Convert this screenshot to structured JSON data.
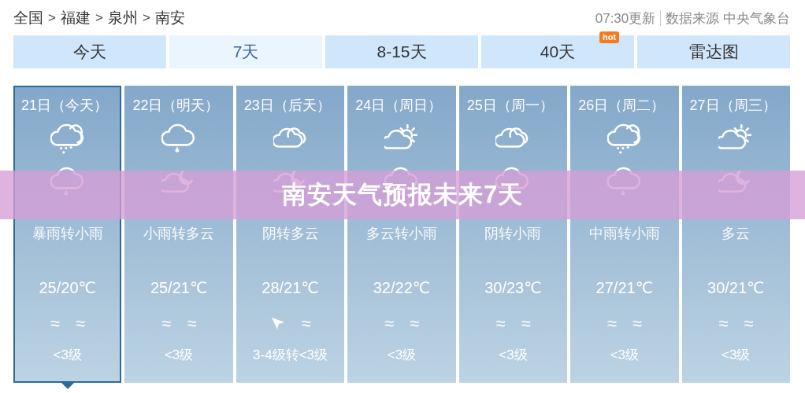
{
  "breadcrumb": [
    "全国",
    "福建",
    "泉州",
    "南安"
  ],
  "breadcrumb_separator": ">",
  "update_time": "07:30更新",
  "source": "数据来源 中央气象台",
  "tabs": [
    {
      "label": "今天",
      "selected": false
    },
    {
      "label": "7天",
      "selected": true
    },
    {
      "label": "8-15天",
      "selected": false
    },
    {
      "label": "40天",
      "selected": false,
      "badge": "hot"
    },
    {
      "label": "雷达图",
      "selected": false
    }
  ],
  "days": [
    {
      "date": "21日（今天）",
      "day_icon": {
        "kind": "heavy_rain"
      },
      "night_icon": {
        "kind": "rain"
      },
      "weather": "暴雨转小雨",
      "temp": "25/20℃",
      "wind": [
        {
          "kind": "text",
          "text": "≈"
        },
        {
          "kind": "text",
          "text": "≈"
        }
      ],
      "level": "<3级",
      "selected": true
    },
    {
      "date": "22日（明天）",
      "day_icon": {
        "kind": "rain"
      },
      "night_icon": {
        "kind": "moon_cloud"
      },
      "weather": "小雨转多云",
      "temp": "25/21℃",
      "wind": [
        {
          "kind": "text",
          "text": "≈"
        },
        {
          "kind": "text",
          "text": "≈"
        }
      ],
      "level": "<3级",
      "selected": false
    },
    {
      "date": "23日（后天）",
      "day_icon": {
        "kind": "overcast"
      },
      "night_icon": {
        "kind": "moon_cloud"
      },
      "weather": "阴转多云",
      "temp": "28/21℃",
      "wind": [
        {
          "kind": "arrow"
        },
        {
          "kind": "text",
          "text": "≈"
        }
      ],
      "level": "3-4级转<3级",
      "selected": false
    },
    {
      "date": "24日（周日）",
      "day_icon": {
        "kind": "sun_cloud"
      },
      "night_icon": {
        "kind": "rain"
      },
      "weather": "多云转小雨",
      "temp": "32/22℃",
      "wind": [
        {
          "kind": "text",
          "text": "≈"
        },
        {
          "kind": "text",
          "text": "≈"
        }
      ],
      "level": "<3级",
      "selected": false
    },
    {
      "date": "25日（周一）",
      "day_icon": {
        "kind": "overcast"
      },
      "night_icon": {
        "kind": "rain"
      },
      "weather": "阴转小雨",
      "temp": "30/23℃",
      "wind": [
        {
          "kind": "text",
          "text": "≈"
        },
        {
          "kind": "text",
          "text": "≈"
        }
      ],
      "level": "<3级",
      "selected": false
    },
    {
      "date": "26日（周二）",
      "day_icon": {
        "kind": "heavy_rain"
      },
      "night_icon": {
        "kind": "rain"
      },
      "weather": "中雨转小雨",
      "temp": "27/21℃",
      "wind": [
        {
          "kind": "text",
          "text": "≈"
        },
        {
          "kind": "text",
          "text": "≈"
        }
      ],
      "level": "<3级",
      "selected": false
    },
    {
      "date": "27日（周三）",
      "day_icon": {
        "kind": "sun_cloud"
      },
      "night_icon": {
        "kind": "moon_cloud"
      },
      "weather": "多云",
      "temp": "30/21℃",
      "wind": [
        {
          "kind": "text",
          "text": "≈"
        },
        {
          "kind": "text",
          "text": "≈"
        }
      ],
      "level": "<3级",
      "selected": false
    }
  ],
  "overlay_title": "南安天气预报未来7天"
}
